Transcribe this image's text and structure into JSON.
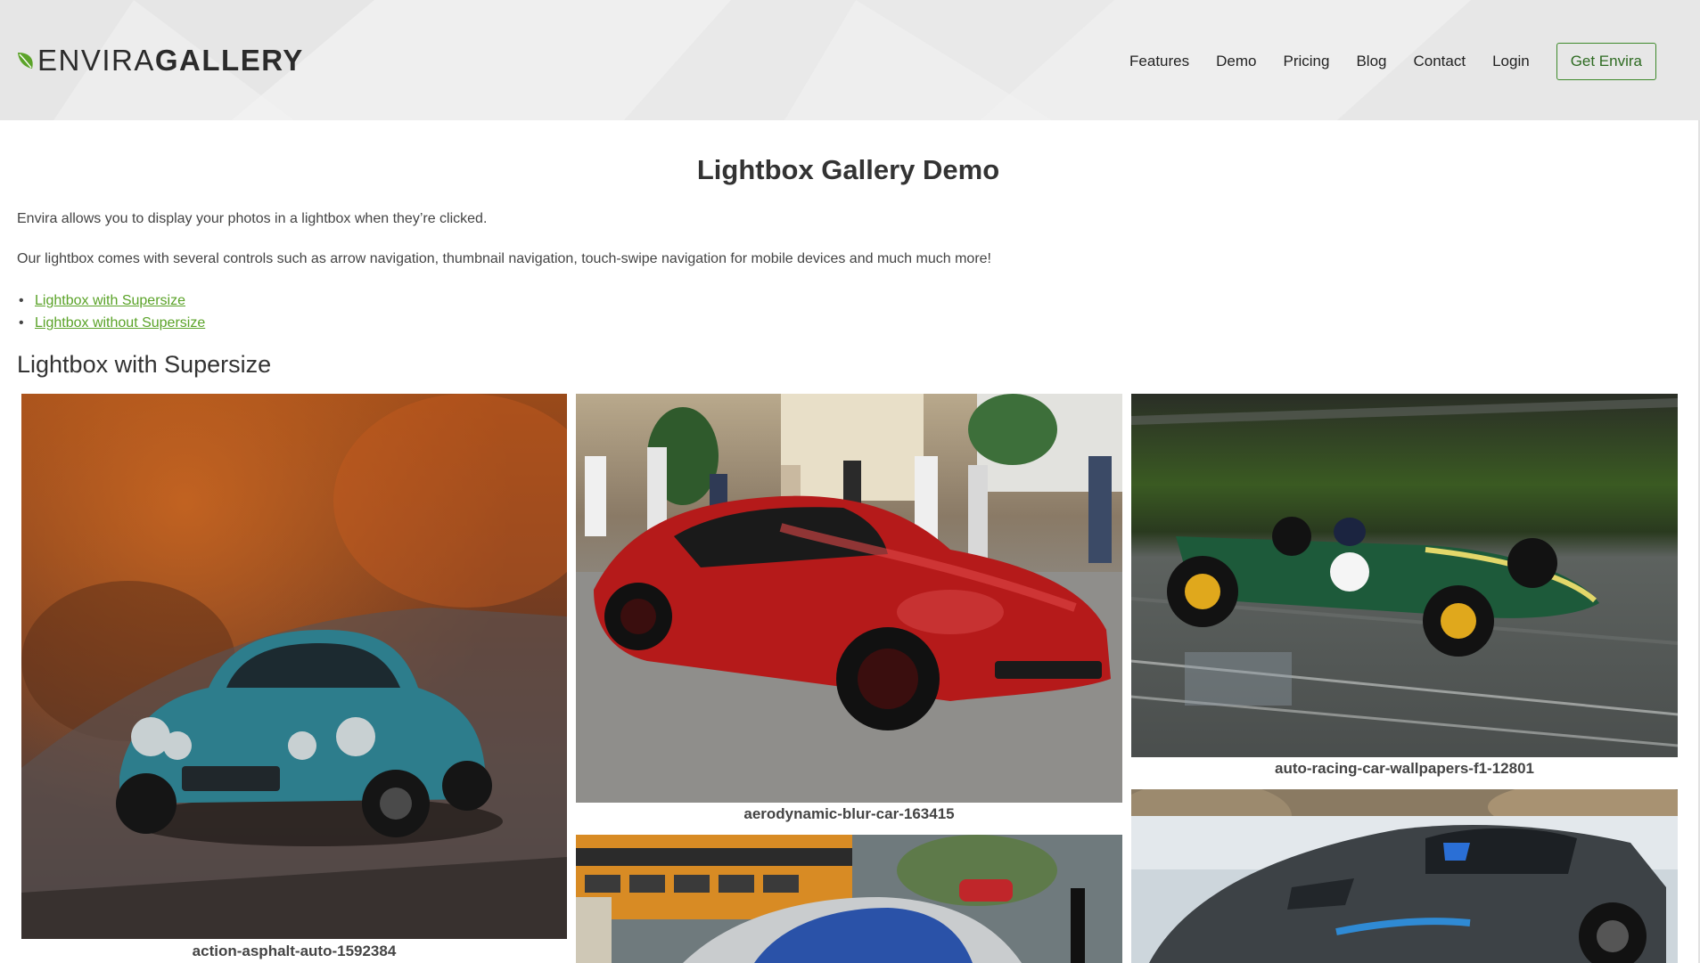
{
  "brand": {
    "logo_light": "ENVIRA",
    "logo_bold": "GALLERY",
    "accent": "#5ba329",
    "leaf_icon": "leaf-icon"
  },
  "nav": {
    "items": [
      "Features",
      "Demo",
      "Pricing",
      "Blog",
      "Contact",
      "Login"
    ],
    "cta": "Get Envira"
  },
  "page": {
    "title": "Lightbox Gallery Demo",
    "intro1": "Envira allows you to display your photos in a lightbox when they’re clicked.",
    "intro2": "Our lightbox comes with several controls such as arrow navigation, thumbnail navigation, touch-swipe navigation for mobile devices and much much more!",
    "links": [
      "Lightbox with Supersize",
      "Lightbox without Supersize"
    ],
    "section_title": "Lightbox with Supersize"
  },
  "gallery": {
    "items": [
      {
        "caption": "action-asphalt-auto-1592384"
      },
      {
        "caption": "aerodynamic-blur-car-163415"
      },
      {
        "caption": "auto-racing-car-wallpapers-f1-12801"
      },
      {
        "caption": ""
      },
      {
        "caption": ""
      }
    ]
  }
}
